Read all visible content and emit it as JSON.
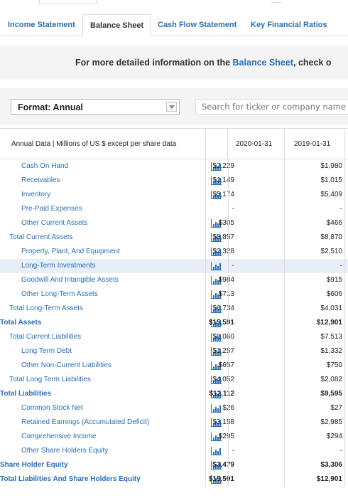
{
  "tabs": [
    {
      "label": "Income Statement",
      "active": false
    },
    {
      "label": "Balance Sheet",
      "active": true
    },
    {
      "label": "Cash Flow Statement",
      "active": false
    },
    {
      "label": "Key Financial Ratios",
      "active": false
    }
  ],
  "banner": {
    "prefix": "For more detailed information on the ",
    "link": "Balance Sheet",
    "suffix": ", check o"
  },
  "format_select": {
    "value": "Format: Annual"
  },
  "search": {
    "placeholder": "Search for ticker or company name"
  },
  "table": {
    "header_label": "Annual Data | Millions of US $ except per share data",
    "dates": [
      "2020-01-31",
      "2019-01-31"
    ],
    "rows": [
      {
        "label": "Cash On Hand",
        "indent": 2,
        "bold": false,
        "icon": true,
        "v1": "$2,229",
        "v2": "$1,980",
        "hl": false
      },
      {
        "label": "Receivables",
        "indent": 2,
        "bold": false,
        "icon": true,
        "v1": "$1,149",
        "v2": "$1,015",
        "hl": false
      },
      {
        "label": "Inventory",
        "indent": 2,
        "bold": false,
        "icon": true,
        "v1": "$5,174",
        "v2": "$5,409",
        "hl": false
      },
      {
        "label": "Pre-Paid Expenses",
        "indent": 2,
        "bold": false,
        "icon": false,
        "v1": "-",
        "v2": "-",
        "hl": false
      },
      {
        "label": "Other Current Assets",
        "indent": 2,
        "bold": false,
        "icon": true,
        "v1": "$305",
        "v2": "$466",
        "hl": false
      },
      {
        "label": "Total Current Assets",
        "indent": 1,
        "bold": false,
        "icon": true,
        "v1": "$8,857",
        "v2": "$8,870",
        "hl": false
      },
      {
        "label": "Property, Plant, And Equipment",
        "indent": 2,
        "bold": false,
        "icon": true,
        "v1": "$2,328",
        "v2": "$2,510",
        "hl": false
      },
      {
        "label": "Long-Term Investments",
        "indent": 2,
        "bold": false,
        "icon": true,
        "v1": "-",
        "v2": "-",
        "hl": true
      },
      {
        "label": "Goodwill And Intangible Assets",
        "indent": 2,
        "bold": false,
        "icon": true,
        "v1": "$984",
        "v2": "$915",
        "hl": false
      },
      {
        "label": "Other Long-Term Assets",
        "indent": 2,
        "bold": false,
        "icon": true,
        "v1": "$713",
        "v2": "$606",
        "hl": false
      },
      {
        "label": "Total Long-Term Assets",
        "indent": 1,
        "bold": false,
        "icon": true,
        "v1": "$6,734",
        "v2": "$4,031",
        "hl": false
      },
      {
        "label": "Total Assets",
        "indent": 0,
        "bold": true,
        "icon": true,
        "v1": "$15,591",
        "v2": "$12,901",
        "hl": false
      },
      {
        "label": "Total Current Liabilities",
        "indent": 1,
        "bold": false,
        "icon": true,
        "v1": "$8,060",
        "v2": "$7,513",
        "hl": false
      },
      {
        "label": "Long Term Debt",
        "indent": 2,
        "bold": false,
        "icon": true,
        "v1": "$1,257",
        "v2": "$1,332",
        "hl": false
      },
      {
        "label": "Other Non-Current Liabilities",
        "indent": 2,
        "bold": false,
        "icon": true,
        "v1": "$657",
        "v2": "$750",
        "hl": false
      },
      {
        "label": "Total Long Term Liabilities",
        "indent": 1,
        "bold": false,
        "icon": true,
        "v1": "$4,052",
        "v2": "$2,082",
        "hl": false
      },
      {
        "label": "Total Liabilities",
        "indent": 0,
        "bold": true,
        "icon": true,
        "v1": "$12,112",
        "v2": "$9,595",
        "hl": false
      },
      {
        "label": "Common Stock Net",
        "indent": 2,
        "bold": false,
        "icon": true,
        "v1": "$26",
        "v2": "$27",
        "hl": false
      },
      {
        "label": "Retained Earnings (Accumulated Deficit)",
        "indent": 2,
        "bold": false,
        "icon": true,
        "v1": "$3,158",
        "v2": "$2,985",
        "hl": false
      },
      {
        "label": "Comprehensive Income",
        "indent": 2,
        "bold": false,
        "icon": true,
        "v1": "$295",
        "v2": "$294",
        "hl": false
      },
      {
        "label": "Other Share Holders Equity",
        "indent": 2,
        "bold": false,
        "icon": true,
        "v1": "-",
        "v2": "-",
        "hl": false
      },
      {
        "label": "Share Holder Equity",
        "indent": 0,
        "bold": true,
        "icon": true,
        "v1": "$3,479",
        "v2": "$3,306",
        "hl": false
      },
      {
        "label": "Total Liabilities And Share Holders Equity",
        "indent": 0,
        "bold": true,
        "icon": true,
        "v1": "$15,591",
        "v2": "$12,901",
        "hl": false
      }
    ]
  },
  "colors": {
    "link": "#2a6fb6",
    "highlight_row": "#e7eef6",
    "panel_bg": "#f4f4f4"
  },
  "icons": {
    "chart": "bar-chart-icon",
    "dropdown": "chevron-down-icon"
  }
}
